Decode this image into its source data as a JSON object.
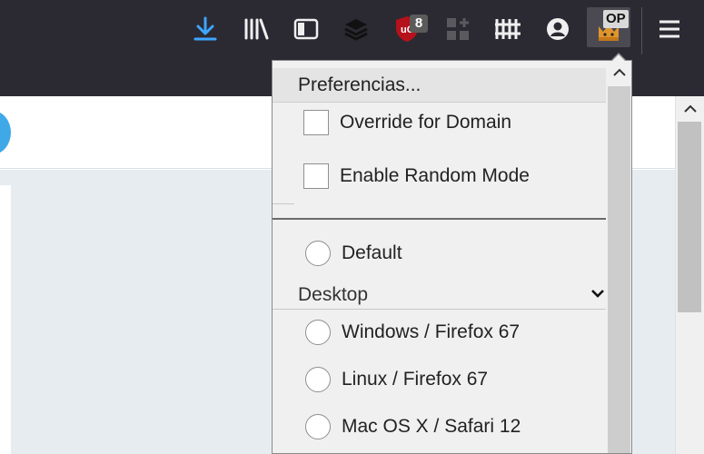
{
  "toolbar": {
    "buttons": [
      {
        "name": "downloads-button",
        "icon": "download-icon"
      },
      {
        "name": "library-button",
        "icon": "library-icon"
      },
      {
        "name": "sidebar-button",
        "icon": "sidebar-icon"
      },
      {
        "name": "layers-extension-button",
        "icon": "layers-icon"
      },
      {
        "name": "ublock-button",
        "icon": "ublock-shield-icon",
        "badge": "8"
      },
      {
        "name": "extension-puzzle-button",
        "icon": "grid-plus-icon"
      },
      {
        "name": "extension-bars-button",
        "icon": "bars-icon"
      },
      {
        "name": "account-button",
        "icon": "account-icon"
      },
      {
        "name": "user-agent-extension-button",
        "icon": "crown-icon",
        "badge": "OP"
      },
      {
        "name": "menu-button",
        "icon": "hamburger-icon"
      }
    ],
    "ublock_badge": "8",
    "ua_badge": "OP"
  },
  "popup": {
    "preferences_label": "Preferencias...",
    "override_domain_label": "Override for Domain",
    "override_domain_checked": false,
    "random_mode_label": "Enable Random Mode",
    "random_mode_checked": false,
    "default_label": "Default",
    "section_title": "Desktop",
    "options": [
      {
        "label": "Windows / Firefox 67",
        "selected": false
      },
      {
        "label": "Linux / Firefox 67",
        "selected": false
      },
      {
        "label": "Mac OS X / Safari 12",
        "selected": false
      }
    ]
  },
  "colors": {
    "toolbar_bg": "#2b2a33",
    "download_accent": "#3ea6ff",
    "ublock_red": "#b5121b",
    "popup_bg": "#f0f0f0",
    "page_body": "#e7ecf1"
  }
}
